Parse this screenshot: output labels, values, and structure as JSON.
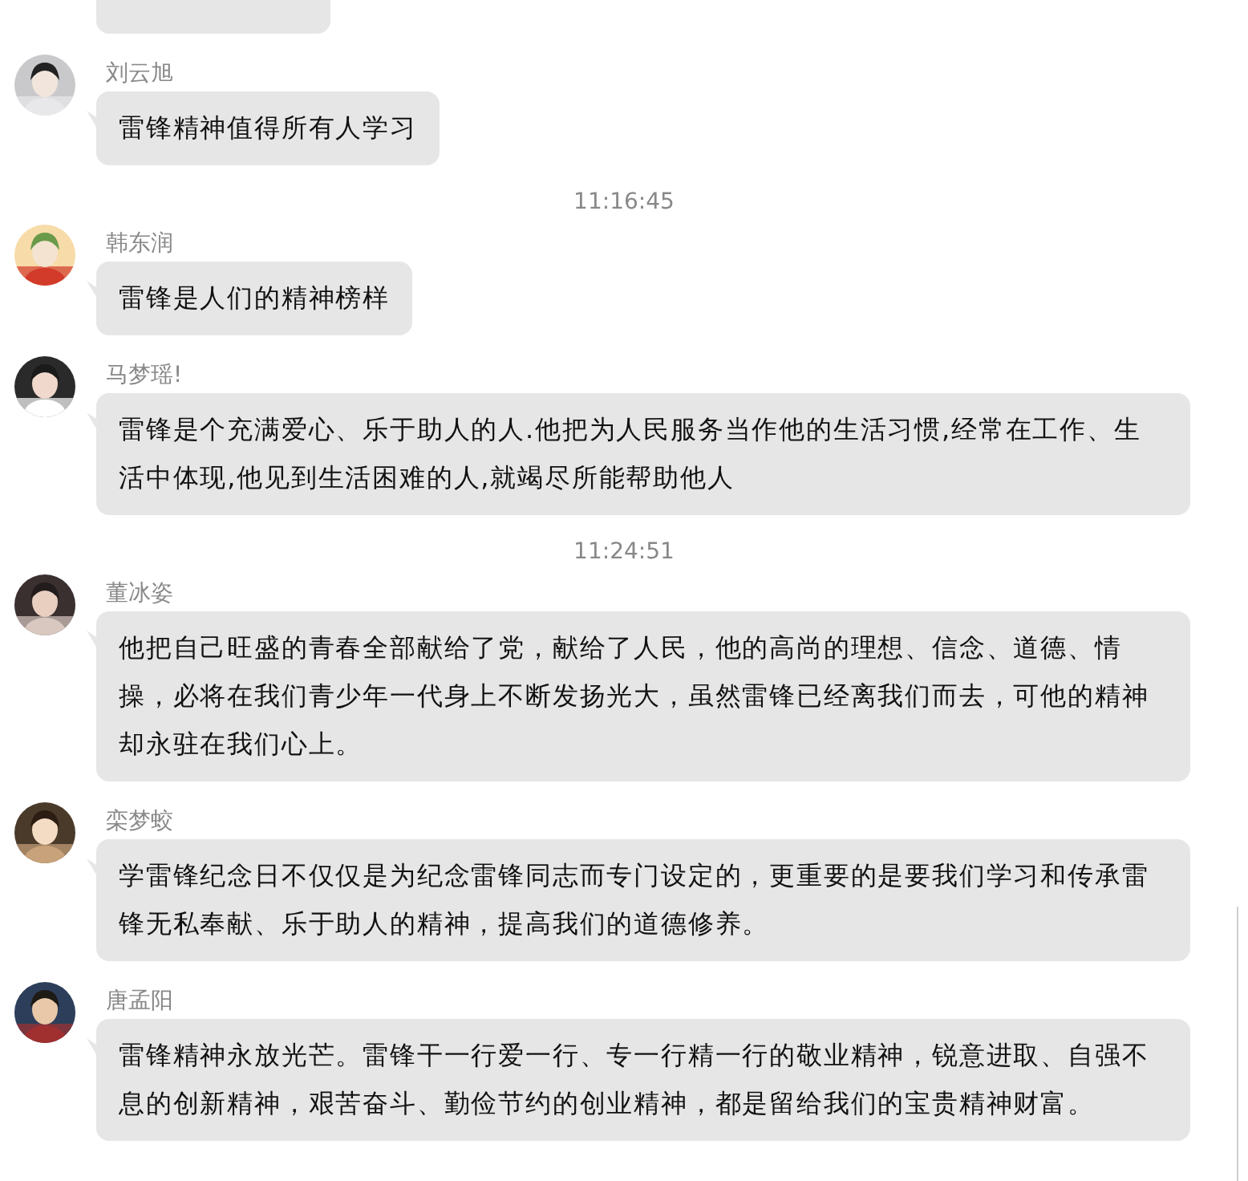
{
  "items": [
    {
      "kind": "message"
    },
    {
      "kind": "message",
      "sender": "刘云旭",
      "text": "雷锋精神值得所有人学习"
    },
    {
      "kind": "time",
      "text": "11:16:45"
    },
    {
      "kind": "message",
      "sender": "韩东润",
      "text": "雷锋是人们的精神榜样"
    },
    {
      "kind": "message",
      "sender": "马梦瑶!",
      "text": "雷锋是个充满爱心、乐于助人的人.他把为人民服务当作他的生活习惯,经常在工作、生活中体现,他见到生活困难的人,就竭尽所能帮助他人"
    },
    {
      "kind": "time",
      "text": "11:24:51"
    },
    {
      "kind": "message",
      "sender": "董冰姿",
      "text": "他把自己旺盛的青春全部献给了党，献给了人民，他的高尚的理想、信念、道德、情操，必将在我们青少年一代身上不断发扬光大，虽然雷锋已经离我们而去，可他的精神却永驻在我们心上。"
    },
    {
      "kind": "message",
      "sender": "栾梦蛟",
      "text": "学雷锋纪念日不仅仅是为纪念雷锋同志而专门设定的，更重要的是要我们学习和传承雷锋无私奉献、乐于助人的精神，提高我们的道德修养。"
    },
    {
      "kind": "message",
      "sender": "唐孟阳",
      "text": "雷锋精神永放光芒。雷锋干一行爱一行、专一行精一行的敬业精神，锐意进取、自强不息的创新精神，艰苦奋斗、勤俭节约的创业精神，都是留给我们的宝贵精神财富。"
    }
  ]
}
